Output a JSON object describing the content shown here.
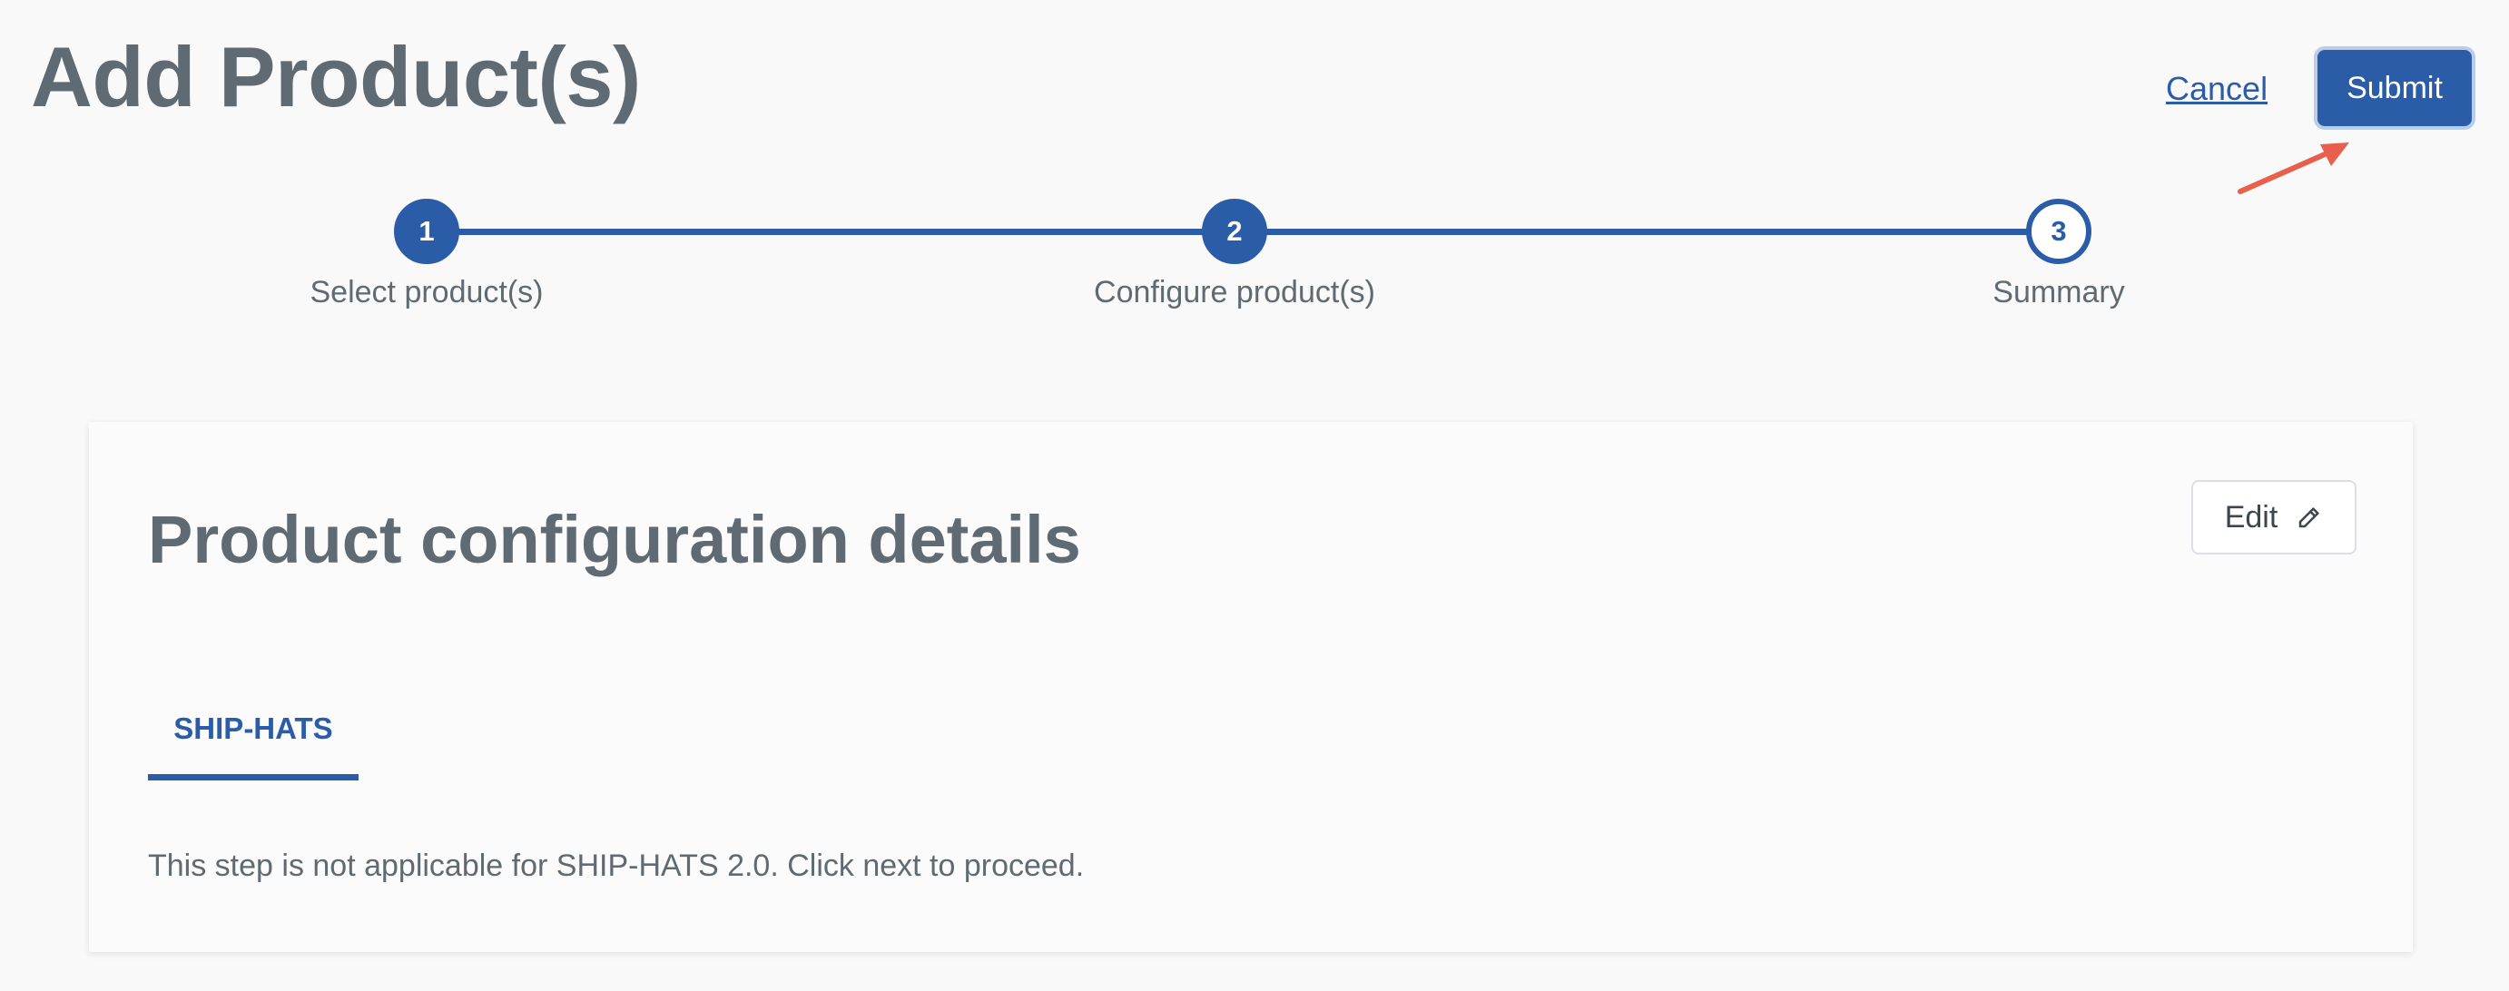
{
  "header": {
    "title": "Add Product(s)",
    "cancel_label": "Cancel",
    "submit_label": "Submit"
  },
  "stepper": {
    "steps": [
      {
        "number": "1",
        "label": "Select product(s)",
        "state": "completed"
      },
      {
        "number": "2",
        "label": "Configure product(s)",
        "state": "completed"
      },
      {
        "number": "3",
        "label": "Summary",
        "state": "current"
      }
    ]
  },
  "card": {
    "title": "Product configuration details",
    "edit_label": "Edit",
    "edit_icon": "pencil-icon",
    "tabs": [
      {
        "label": "SHIP-HATS",
        "active": true
      }
    ],
    "message": "This step is not applicable for SHIP-HATS 2.0. Click next to proceed."
  },
  "colors": {
    "primary": "#2a5ca8",
    "text": "#5f6a73",
    "background": "#f9f9f9",
    "annotation_arrow": "#e8604c"
  }
}
